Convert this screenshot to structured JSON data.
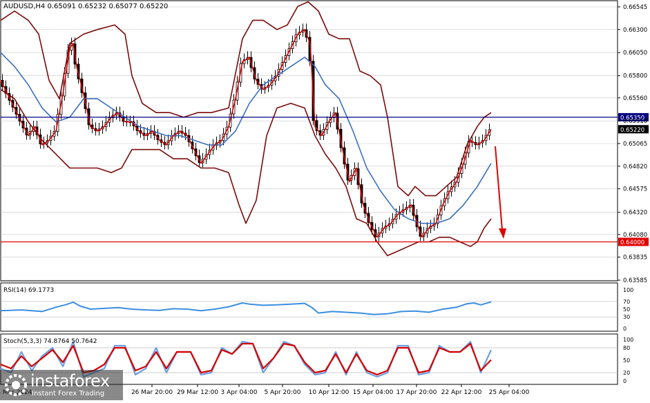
{
  "header": {
    "symbol_line": "AUDUSD,H4  0.65091 0.65232 0.65077 0.65220"
  },
  "price_panel": {
    "ylim": [
      0.63585,
      0.66545
    ],
    "ticks": [
      "0.66545",
      "0.66300",
      "0.66050",
      "0.65800",
      "0.65560",
      "0.65310",
      "0.65065",
      "0.64820",
      "0.64575",
      "0.64320",
      "0.64080",
      "0.63835",
      "0.63585"
    ],
    "tick_values": [
      0.66545,
      0.663,
      0.6605,
      0.658,
      0.6556,
      0.6531,
      0.65065,
      0.6482,
      0.64575,
      0.6432,
      0.6408,
      0.63835,
      0.63585
    ],
    "level_resistance": {
      "value": 0.6535,
      "label": "0.65350",
      "color": "#000080"
    },
    "level_support": {
      "value": 0.64,
      "label": "0.64000",
      "color": "#e00000"
    },
    "current_price": {
      "value": 0.6522,
      "label": "0.65220"
    }
  },
  "rsi_panel": {
    "label": "RSI(14) 69.1773",
    "ticks": [
      "100",
      "70",
      "50",
      "30",
      "0"
    ],
    "tick_values": [
      100,
      70,
      50,
      30,
      0
    ]
  },
  "stoch_panel": {
    "label": "Stoch(5,3,3) 74.8764 50.7642",
    "ticks": [
      "100",
      "80",
      "50",
      "20",
      "0"
    ],
    "tick_values": [
      100,
      80,
      50,
      20,
      0
    ]
  },
  "time_axis": {
    "labels": [
      "14 Mar 2024",
      "26 Mar 20:00",
      "29 Mar 12:00",
      "3 Apr 04:00",
      "5 Apr 20:00",
      "10 Apr 12:00",
      "15 Apr 04:00",
      "17 Apr 20:00",
      "22 Apr 12:00",
      "25 Apr 04:00"
    ]
  },
  "watermark": {
    "brand": "instaforex",
    "tagline": "Instant Forex Trading"
  },
  "colors": {
    "candle": "#000000",
    "bollinger": "#7a0a0a",
    "ma_fast": "#d40000",
    "ma_slow": "#3a6fc0",
    "rsi_line": "#3a8ee0",
    "stoch_main": "#6c9fe0",
    "stoch_signal": "#d40000",
    "arrow": "#e00000",
    "grid": "#c8c8c8"
  },
  "chart_data": {
    "type": "line",
    "symbol": "AUDUSD",
    "timeframe": "H4",
    "ohlc_last": {
      "open": 0.65091,
      "high": 0.65232,
      "low": 0.65077,
      "close": 0.6522
    },
    "close_path": [
      [
        0,
        0.6575
      ],
      [
        10,
        0.656
      ],
      [
        20,
        0.6545
      ],
      [
        30,
        0.653
      ],
      [
        40,
        0.6515
      ],
      [
        50,
        0.6525
      ],
      [
        60,
        0.6505
      ],
      [
        70,
        0.651
      ],
      [
        80,
        0.652
      ],
      [
        90,
        0.656
      ],
      [
        100,
        0.661
      ],
      [
        105,
        0.6615
      ],
      [
        110,
        0.659
      ],
      [
        120,
        0.656
      ],
      [
        130,
        0.6525
      ],
      [
        140,
        0.652
      ],
      [
        150,
        0.6525
      ],
      [
        160,
        0.6535
      ],
      [
        170,
        0.654
      ],
      [
        180,
        0.653
      ],
      [
        190,
        0.653
      ],
      [
        200,
        0.652
      ],
      [
        210,
        0.6515
      ],
      [
        220,
        0.652
      ],
      [
        230,
        0.651
      ],
      [
        240,
        0.6505
      ],
      [
        250,
        0.6515
      ],
      [
        260,
        0.652
      ],
      [
        270,
        0.6515
      ],
      [
        280,
        0.65
      ],
      [
        290,
        0.6485
      ],
      [
        300,
        0.6495
      ],
      [
        310,
        0.6505
      ],
      [
        320,
        0.651
      ],
      [
        330,
        0.6525
      ],
      [
        340,
        0.6555
      ],
      [
        350,
        0.6595
      ],
      [
        360,
        0.66
      ],
      [
        370,
        0.6575
      ],
      [
        380,
        0.6565
      ],
      [
        390,
        0.657
      ],
      [
        400,
        0.658
      ],
      [
        410,
        0.6595
      ],
      [
        420,
        0.661
      ],
      [
        430,
        0.6625
      ],
      [
        440,
        0.663
      ],
      [
        448,
        0.6615
      ],
      [
        455,
        0.6525
      ],
      [
        465,
        0.6515
      ],
      [
        475,
        0.653
      ],
      [
        485,
        0.654
      ],
      [
        495,
        0.65
      ],
      [
        505,
        0.6465
      ],
      [
        515,
        0.648
      ],
      [
        525,
        0.644
      ],
      [
        535,
        0.642
      ],
      [
        545,
        0.6405
      ],
      [
        555,
        0.6415
      ],
      [
        565,
        0.642
      ],
      [
        575,
        0.643
      ],
      [
        585,
        0.6435
      ],
      [
        595,
        0.644
      ],
      [
        605,
        0.6415
      ],
      [
        610,
        0.6405
      ],
      [
        620,
        0.6415
      ],
      [
        630,
        0.642
      ],
      [
        640,
        0.644
      ],
      [
        650,
        0.6455
      ],
      [
        660,
        0.6465
      ],
      [
        670,
        0.6485
      ],
      [
        680,
        0.651
      ],
      [
        690,
        0.6505
      ],
      [
        700,
        0.651
      ],
      [
        710,
        0.6522
      ]
    ],
    "upper_band": [
      [
        0,
        0.664
      ],
      [
        20,
        0.665
      ],
      [
        40,
        0.664
      ],
      [
        55,
        0.6625
      ],
      [
        70,
        0.6575
      ],
      [
        85,
        0.6555
      ],
      [
        100,
        0.6615
      ],
      [
        120,
        0.6625
      ],
      [
        140,
        0.663
      ],
      [
        165,
        0.6635
      ],
      [
        180,
        0.6625
      ],
      [
        190,
        0.658
      ],
      [
        205,
        0.655
      ],
      [
        225,
        0.654
      ],
      [
        245,
        0.654
      ],
      [
        265,
        0.6535
      ],
      [
        285,
        0.654
      ],
      [
        305,
        0.654
      ],
      [
        330,
        0.6545
      ],
      [
        350,
        0.662
      ],
      [
        365,
        0.664
      ],
      [
        380,
        0.664
      ],
      [
        400,
        0.663
      ],
      [
        415,
        0.6635
      ],
      [
        430,
        0.6655
      ],
      [
        445,
        0.666
      ],
      [
        460,
        0.665
      ],
      [
        475,
        0.6625
      ],
      [
        490,
        0.662
      ],
      [
        505,
        0.662
      ],
      [
        520,
        0.6585
      ],
      [
        535,
        0.658
      ],
      [
        550,
        0.657
      ],
      [
        560,
        0.6535
      ],
      [
        575,
        0.646
      ],
      [
        590,
        0.645
      ],
      [
        600,
        0.646
      ],
      [
        615,
        0.645
      ],
      [
        630,
        0.645
      ],
      [
        645,
        0.646
      ],
      [
        660,
        0.647
      ],
      [
        675,
        0.6505
      ],
      [
        690,
        0.6525
      ],
      [
        700,
        0.6535
      ],
      [
        710,
        0.654
      ]
    ],
    "lower_band": [
      [
        0,
        0.6565
      ],
      [
        20,
        0.6555
      ],
      [
        40,
        0.653
      ],
      [
        60,
        0.651
      ],
      [
        80,
        0.6495
      ],
      [
        100,
        0.648
      ],
      [
        120,
        0.648
      ],
      [
        140,
        0.648
      ],
      [
        160,
        0.6475
      ],
      [
        175,
        0.648
      ],
      [
        190,
        0.65
      ],
      [
        210,
        0.65
      ],
      [
        230,
        0.65
      ],
      [
        250,
        0.649
      ],
      [
        270,
        0.649
      ],
      [
        290,
        0.648
      ],
      [
        310,
        0.648
      ],
      [
        330,
        0.6475
      ],
      [
        345,
        0.644
      ],
      [
        355,
        0.642
      ],
      [
        370,
        0.6445
      ],
      [
        385,
        0.6515
      ],
      [
        400,
        0.6545
      ],
      [
        420,
        0.655
      ],
      [
        440,
        0.6545
      ],
      [
        455,
        0.6515
      ],
      [
        470,
        0.6495
      ],
      [
        485,
        0.648
      ],
      [
        500,
        0.646
      ],
      [
        515,
        0.6425
      ],
      [
        530,
        0.642
      ],
      [
        545,
        0.64
      ],
      [
        560,
        0.6385
      ],
      [
        575,
        0.639
      ],
      [
        590,
        0.6395
      ],
      [
        605,
        0.64
      ],
      [
        620,
        0.64
      ],
      [
        635,
        0.6405
      ],
      [
        650,
        0.6405
      ],
      [
        665,
        0.64
      ],
      [
        680,
        0.6395
      ],
      [
        690,
        0.64
      ],
      [
        700,
        0.6415
      ],
      [
        710,
        0.6425
      ]
    ],
    "ma_slow": [
      [
        0,
        0.6605
      ],
      [
        20,
        0.659
      ],
      [
        40,
        0.657
      ],
      [
        60,
        0.6545
      ],
      [
        80,
        0.653
      ],
      [
        100,
        0.6535
      ],
      [
        120,
        0.6555
      ],
      [
        140,
        0.6555
      ],
      [
        160,
        0.6545
      ],
      [
        180,
        0.6535
      ],
      [
        200,
        0.6525
      ],
      [
        220,
        0.652
      ],
      [
        240,
        0.6515
      ],
      [
        260,
        0.6515
      ],
      [
        280,
        0.651
      ],
      [
        300,
        0.6505
      ],
      [
        320,
        0.6505
      ],
      [
        340,
        0.652
      ],
      [
        360,
        0.655
      ],
      [
        380,
        0.657
      ],
      [
        400,
        0.658
      ],
      [
        420,
        0.659
      ],
      [
        440,
        0.66
      ],
      [
        455,
        0.659
      ],
      [
        470,
        0.657
      ],
      [
        490,
        0.6555
      ],
      [
        510,
        0.652
      ],
      [
        530,
        0.648
      ],
      [
        550,
        0.6455
      ],
      [
        570,
        0.6435
      ],
      [
        590,
        0.6425
      ],
      [
        610,
        0.642
      ],
      [
        630,
        0.642
      ],
      [
        650,
        0.6425
      ],
      [
        670,
        0.644
      ],
      [
        690,
        0.646
      ],
      [
        710,
        0.6485
      ]
    ],
    "rsi": [
      [
        0,
        46
      ],
      [
        30,
        48
      ],
      [
        60,
        44
      ],
      [
        80,
        55
      ],
      [
        95,
        62
      ],
      [
        105,
        68
      ],
      [
        115,
        58
      ],
      [
        130,
        50
      ],
      [
        150,
        52
      ],
      [
        170,
        54
      ],
      [
        190,
        50
      ],
      [
        210,
        48
      ],
      [
        230,
        47
      ],
      [
        250,
        51
      ],
      [
        270,
        50
      ],
      [
        290,
        46
      ],
      [
        310,
        50
      ],
      [
        330,
        56
      ],
      [
        350,
        66
      ],
      [
        360,
        63
      ],
      [
        380,
        60
      ],
      [
        400,
        61
      ],
      [
        420,
        63
      ],
      [
        440,
        65
      ],
      [
        450,
        55
      ],
      [
        460,
        40
      ],
      [
        480,
        44
      ],
      [
        500,
        42
      ],
      [
        520,
        40
      ],
      [
        540,
        36
      ],
      [
        560,
        38
      ],
      [
        580,
        44
      ],
      [
        600,
        45
      ],
      [
        620,
        42
      ],
      [
        640,
        50
      ],
      [
        660,
        55
      ],
      [
        675,
        64
      ],
      [
        685,
        66
      ],
      [
        695,
        61
      ],
      [
        710,
        69
      ]
    ],
    "stoch_main": [
      [
        0,
        30
      ],
      [
        15,
        20
      ],
      [
        30,
        70
      ],
      [
        45,
        25
      ],
      [
        60,
        60
      ],
      [
        75,
        80
      ],
      [
        90,
        35
      ],
      [
        105,
        95
      ],
      [
        120,
        10
      ],
      [
        135,
        20
      ],
      [
        150,
        30
      ],
      [
        165,
        85
      ],
      [
        180,
        85
      ],
      [
        195,
        15
      ],
      [
        210,
        30
      ],
      [
        225,
        80
      ],
      [
        240,
        20
      ],
      [
        255,
        70
      ],
      [
        275,
        70
      ],
      [
        290,
        15
      ],
      [
        305,
        20
      ],
      [
        320,
        80
      ],
      [
        335,
        65
      ],
      [
        350,
        95
      ],
      [
        365,
        90
      ],
      [
        380,
        20
      ],
      [
        395,
        55
      ],
      [
        410,
        95
      ],
      [
        425,
        85
      ],
      [
        440,
        40
      ],
      [
        455,
        15
      ],
      [
        470,
        20
      ],
      [
        485,
        70
      ],
      [
        500,
        15
      ],
      [
        515,
        70
      ],
      [
        530,
        20
      ],
      [
        545,
        10
      ],
      [
        560,
        20
      ],
      [
        575,
        85
      ],
      [
        590,
        85
      ],
      [
        605,
        15
      ],
      [
        620,
        20
      ],
      [
        635,
        85
      ],
      [
        650,
        70
      ],
      [
        665,
        70
      ],
      [
        680,
        95
      ],
      [
        695,
        20
      ],
      [
        710,
        74.8764
      ]
    ],
    "stoch_signal": [
      [
        0,
        40
      ],
      [
        15,
        30
      ],
      [
        30,
        60
      ],
      [
        45,
        35
      ],
      [
        60,
        55
      ],
      [
        75,
        75
      ],
      [
        90,
        45
      ],
      [
        105,
        85
      ],
      [
        120,
        20
      ],
      [
        135,
        25
      ],
      [
        150,
        40
      ],
      [
        165,
        80
      ],
      [
        180,
        80
      ],
      [
        195,
        25
      ],
      [
        210,
        35
      ],
      [
        225,
        70
      ],
      [
        240,
        30
      ],
      [
        255,
        70
      ],
      [
        275,
        70
      ],
      [
        290,
        20
      ],
      [
        305,
        25
      ],
      [
        320,
        75
      ],
      [
        335,
        65
      ],
      [
        350,
        90
      ],
      [
        365,
        90
      ],
      [
        380,
        30
      ],
      [
        395,
        55
      ],
      [
        410,
        90
      ],
      [
        425,
        85
      ],
      [
        440,
        45
      ],
      [
        455,
        20
      ],
      [
        470,
        25
      ],
      [
        485,
        65
      ],
      [
        500,
        20
      ],
      [
        515,
        65
      ],
      [
        530,
        25
      ],
      [
        545,
        15
      ],
      [
        560,
        25
      ],
      [
        575,
        80
      ],
      [
        590,
        80
      ],
      [
        605,
        20
      ],
      [
        620,
        25
      ],
      [
        635,
        80
      ],
      [
        650,
        70
      ],
      [
        665,
        70
      ],
      [
        680,
        90
      ],
      [
        695,
        25
      ],
      [
        710,
        50.7642
      ]
    ]
  }
}
